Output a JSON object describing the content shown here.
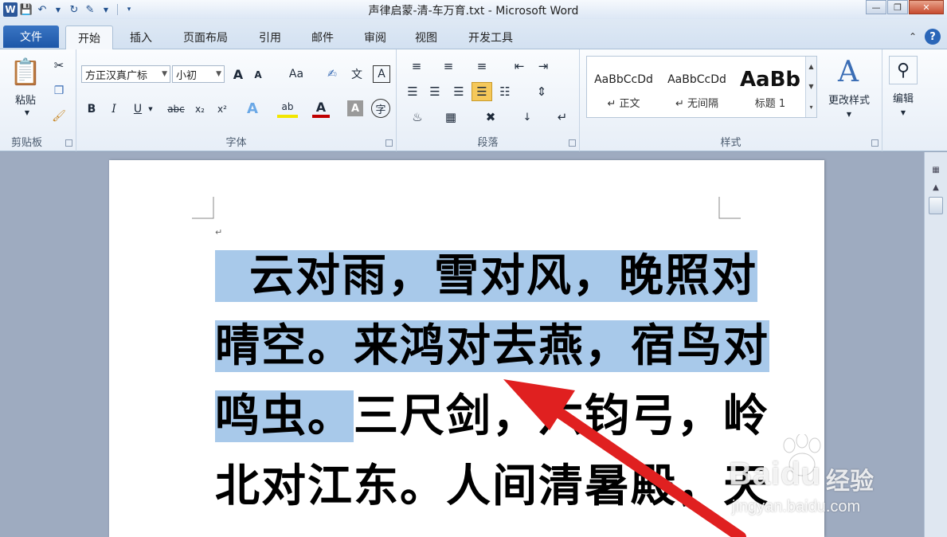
{
  "window": {
    "title": "声律启蒙-清-车万育.txt  -  Microsoft Word"
  },
  "tabs": {
    "file": "文件",
    "items": [
      "开始",
      "插入",
      "页面布局",
      "引用",
      "邮件",
      "审阅",
      "视图",
      "开发工具"
    ],
    "active": "开始"
  },
  "ribbon": {
    "clipboard": {
      "label": "剪贴板",
      "paste": "粘贴"
    },
    "font": {
      "label": "字体",
      "font_name": "方正汉真广标",
      "font_size": "小初",
      "grow": "A",
      "shrink": "A",
      "case": "Aa",
      "bold": "B",
      "italic": "I",
      "underline": "U",
      "strike": "abc",
      "subscript": "x₂",
      "superscript": "x²",
      "text_effect": "A",
      "highlight": "ab",
      "font_color": "A",
      "char_shading": "A",
      "enclose": "字"
    },
    "paragraph": {
      "label": "段落"
    },
    "styles": {
      "label": "样式",
      "items": [
        {
          "sample": "AaBbCcDd",
          "name": "↵ 正文"
        },
        {
          "sample": "AaBbCcDd",
          "name": "↵ 无间隔"
        },
        {
          "sample": "AaBb",
          "name": "标题 1"
        }
      ],
      "change": "更改样式"
    },
    "editing": {
      "label": "编辑"
    }
  },
  "document": {
    "lines": [
      {
        "selected": "  云对雨，雪对风，晚照对",
        "rest": ""
      },
      {
        "selected": "晴空。来鸿对去燕，宿鸟对",
        "rest": ""
      },
      {
        "selected": "鸣虫。",
        "rest": "三尺剑，六钧弓，岭"
      },
      {
        "selected": "",
        "rest": "北对江东。人间清暑殿，天"
      }
    ]
  },
  "watermark": {
    "brand": "Baidu",
    "cn": "经验",
    "url": "jingyan.baidu.com"
  },
  "colors": {
    "selection": "#a8c9ea",
    "arrow": "#e02020",
    "accent": "#2b579a"
  }
}
